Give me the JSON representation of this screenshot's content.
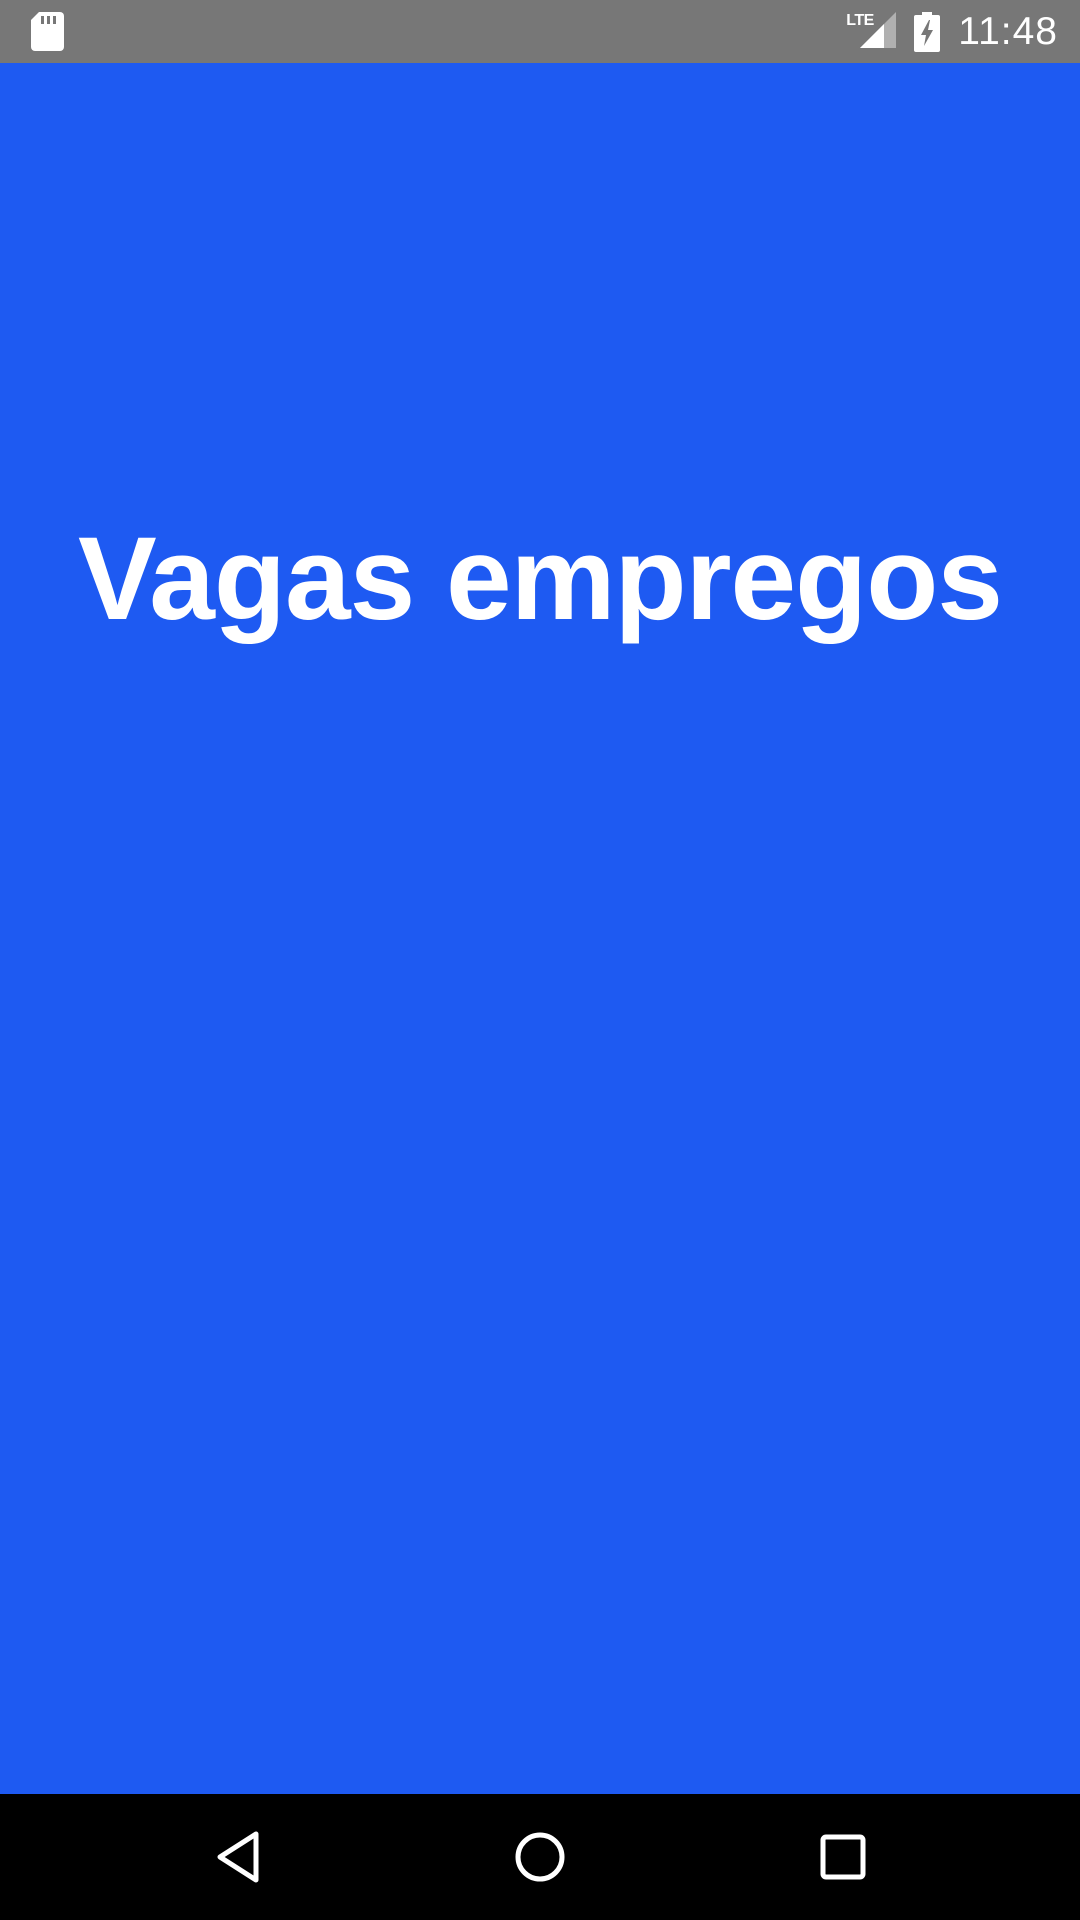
{
  "status_bar": {
    "clock": "11:48",
    "network_label": "LTE",
    "left_icon": "sd-card-icon",
    "signal_icon": "cell-signal-icon",
    "battery_icon": "battery-charging-icon",
    "background_color": "#777777"
  },
  "main": {
    "title": "Vagas empregos",
    "background_color": "#1e5af2",
    "text_color": "#ffffff"
  },
  "nav_bar": {
    "back_icon": "back-triangle-icon",
    "home_icon": "home-circle-icon",
    "recents_icon": "recents-square-icon",
    "background_color": "#000000"
  }
}
